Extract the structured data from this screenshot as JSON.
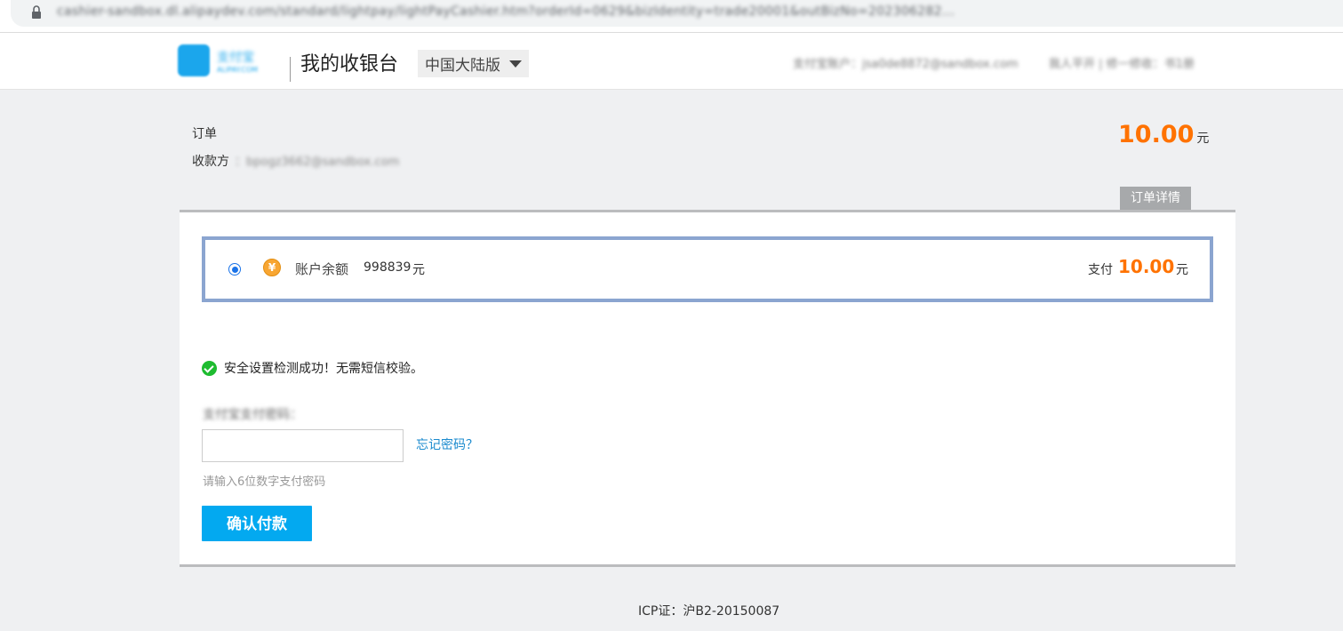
{
  "browser": {
    "url": "cashier-sandbox.dl.alipaydev.com/standard/lightpay/lightPayCashier.htm?orderId=0629&bizIdentity=trade20001&outBizNo=202306282..."
  },
  "header": {
    "logo_text": "支付宝",
    "logo_sub": "ALIPAY.COM",
    "site_title": "我的收银台",
    "region": "中国大陆版",
    "account_text": "支付宝账户：jsa0de8872@sandbox.com",
    "links_text": "我人平开  |  修一修收：书1册"
  },
  "order": {
    "label": "订单",
    "payee_label": "收款方",
    "payee_value": "：bpogz3662@sandbox.com",
    "amount": "10.00",
    "unit": "元",
    "details_tab": "订单详情"
  },
  "payment_method": {
    "coin_symbol": "¥",
    "label": "账户余额",
    "balance": "998839",
    "unit": "元",
    "pay_label": "支付",
    "pay_amount": "10.00",
    "pay_unit": "元"
  },
  "security": {
    "message": "安全设置检测成功！无需短信校验。"
  },
  "password": {
    "label": "支付宝支付密码：",
    "value": "",
    "forgot_link": "忘记密码？",
    "hint": "请输入6位数字支付密码"
  },
  "confirm_button": "确认付款",
  "footer": {
    "icp": "ICP证：沪B2-20150087"
  }
}
